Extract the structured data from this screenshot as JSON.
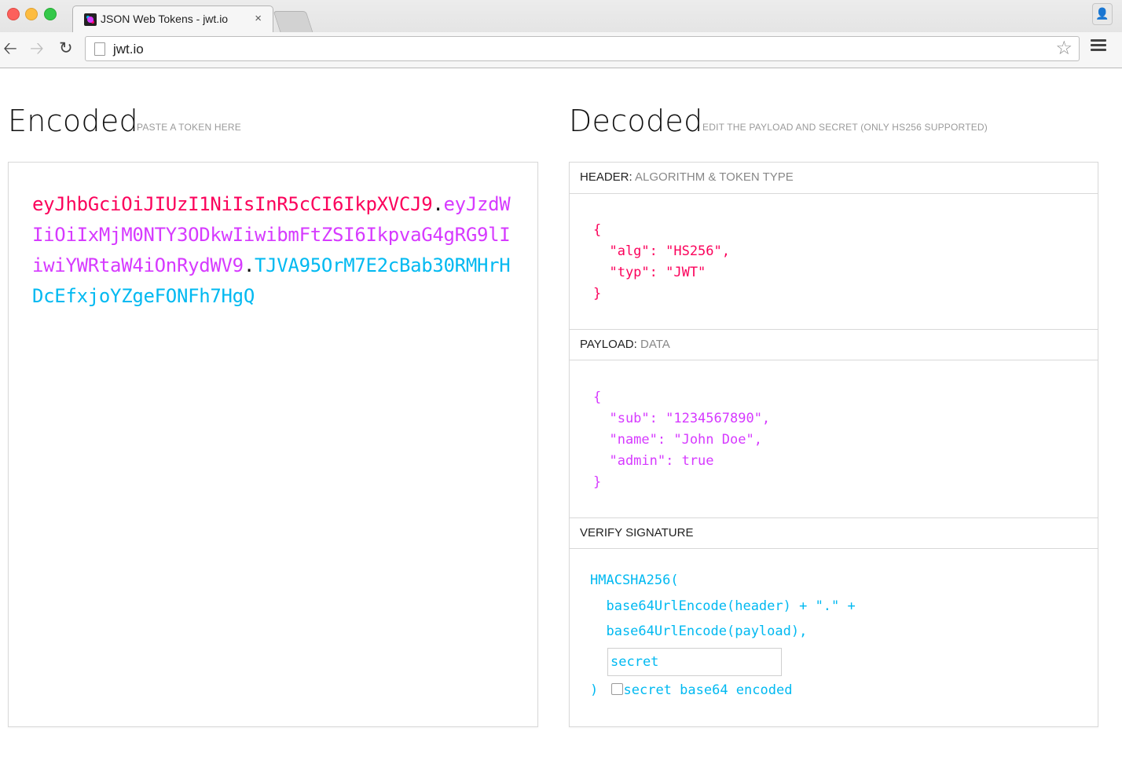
{
  "browser": {
    "tab_title": "JSON Web Tokens - jwt.io",
    "tab_close": "×",
    "url": "jwt.io",
    "icons": [
      "close-icon",
      "back-arrow-icon",
      "forward-arrow-icon",
      "reload-icon",
      "page-icon",
      "star-icon",
      "menu-icon",
      "profile-icon"
    ]
  },
  "encoded": {
    "title": "Encoded",
    "subtitle": "PASTE A TOKEN HERE",
    "token": {
      "header": "eyJhbGciOiJIUzI1NiIsInR5cCI6IkpXVCJ9",
      "dot1": ".",
      "payload": "eyJzdWIiOiIxMjM0NTY3ODkwIiwibmFtZSI6IkpvaG4gRG9lIiwiYWRtaW4iOnRydWV9",
      "dot2": ".",
      "signature": "TJVA95OrM7E2cBab30RMHrHDcEfxjoYZgeFONFh7HgQ"
    }
  },
  "decoded": {
    "title": "Decoded",
    "subtitle": "EDIT THE PAYLOAD AND SECRET (ONLY HS256 SUPPORTED)",
    "header_section": {
      "label": "HEADER:",
      "sublabel": "ALGORITHM & TOKEN TYPE",
      "json": "{\n  \"alg\": \"HS256\",\n  \"typ\": \"JWT\"\n}"
    },
    "payload_section": {
      "label": "PAYLOAD:",
      "sublabel": "DATA",
      "json": "{\n  \"sub\": \"1234567890\",\n  \"name\": \"John Doe\",\n  \"admin\": true\n}"
    },
    "verify_section": {
      "label": "VERIFY SIGNATURE",
      "line1": "HMACSHA256(",
      "line2": "  base64UrlEncode(header) + \".\" +",
      "line3": "  base64UrlEncode(payload),",
      "secret_placeholder": "secret",
      "close_paren": ")",
      "checkbox_label": "secret base64 encoded"
    }
  },
  "colors": {
    "header": "#fb015b",
    "payload": "#d63aff",
    "signature": "#00b9f1"
  }
}
